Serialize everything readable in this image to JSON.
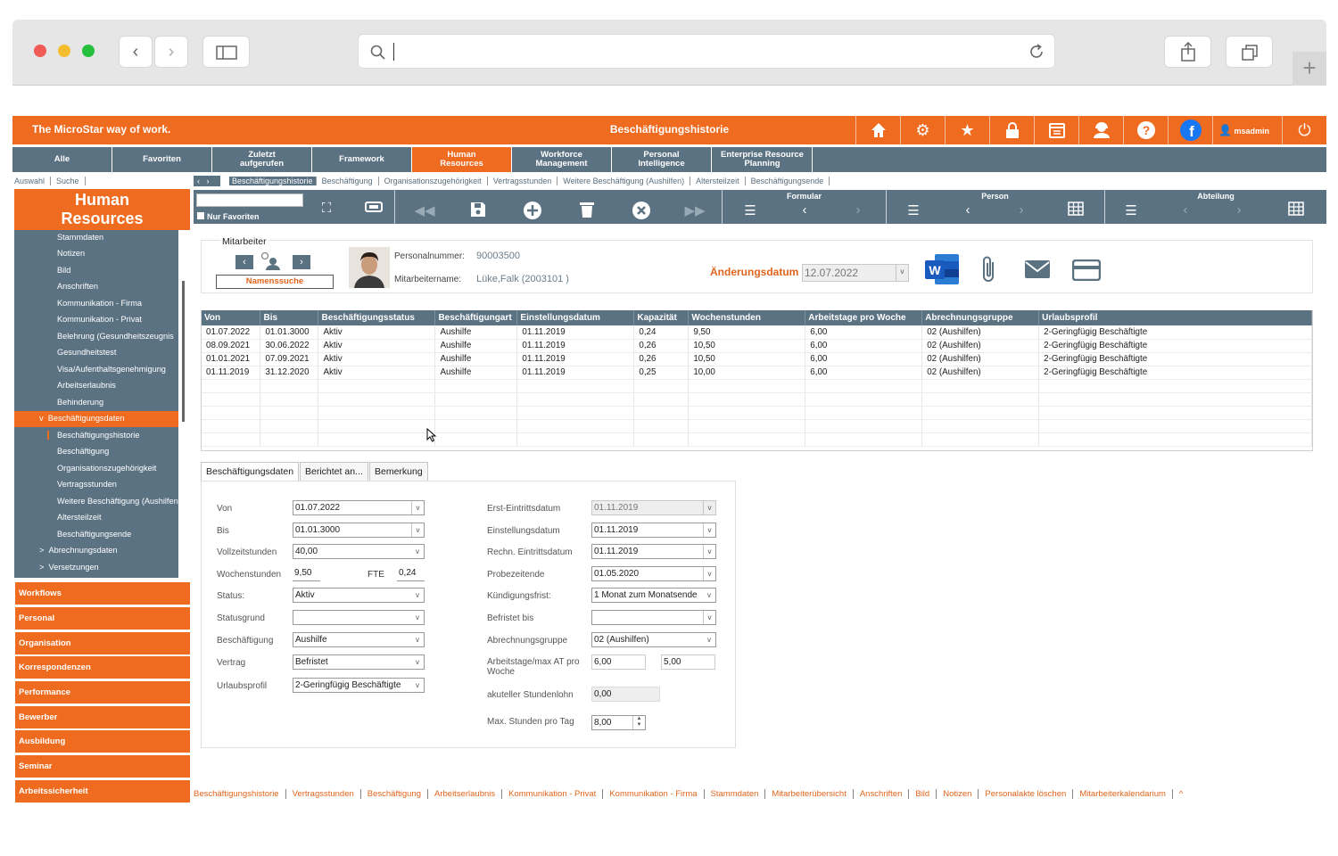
{
  "brand": "The MicroStar way of work.",
  "title": "Beschäftigungshistorie",
  "user": "msadmin",
  "nav": [
    {
      "label": "Alle"
    },
    {
      "label": "Favoriten"
    },
    {
      "label": "Zuletzt aufgerufen"
    },
    {
      "label": "Framework"
    },
    {
      "label": "Human Resources"
    },
    {
      "label": "Workforce Management"
    },
    {
      "label": "Personal Intelligence"
    },
    {
      "label": "Enterprise Resource Planning"
    }
  ],
  "subnav": {
    "left": [
      "Auswahl",
      "Suche"
    ],
    "crumbs": [
      "Beschäftigungshistorie",
      "Beschäftigung",
      "Organisationszugehörigkeit",
      "Vertragsstunden",
      "Weitere Beschäftigung (Aushilfen)",
      "Altersteilzeit",
      "Beschäftigungsende"
    ]
  },
  "module": {
    "title": "Human Resources"
  },
  "tree": [
    "Stammdaten",
    "Notizen",
    "Bild",
    "Anschriften",
    "Kommunikation - Firma",
    "Kommunikation - Privat",
    "Belehrung (Gesundheitszeugnis",
    "Gesundheitstest",
    "Visa/Aufenthaltsgenehmigung",
    "Arbeitserlaubnis",
    "Behinderung",
    "Beschäftigungsdaten",
    "Beschäftigungshistorie",
    "Beschäftigung",
    "Organisationszugehörigkeit",
    "Vertragsstunden",
    "Weitere Beschäftigung (Aushilfen",
    "Altersteilzeit",
    "Beschäftigungsende",
    "Abrechnungsdaten",
    "Versetzungen"
  ],
  "modules": [
    "Workflows",
    "Personal",
    "Organisation",
    "Korrespondenzen",
    "Performance",
    "Bewerber",
    "Ausbildung",
    "Seminar",
    "Arbeitssicherheit"
  ],
  "toolbar": {
    "favorites": "Nur Favoriten",
    "groups": [
      "Formular",
      "Person",
      "Abteilung"
    ]
  },
  "employee": {
    "section": "Mitarbeiter",
    "search": "Namenssuche",
    "nr_label": "Personalnummer:",
    "nr": "90003500",
    "name_label": "Mitarbeitername:",
    "name": "Lüke,Falk (2003101 )",
    "change_label": "Änderungsdatum",
    "change_date": "12.07.2022"
  },
  "table": {
    "columns": [
      "Von",
      "Bis",
      "Beschäftigungsstatus",
      "Beschäftigungart",
      "Einstellungsdatum",
      "Kapazität",
      "Wochenstunden",
      "Arbeitstage pro Woche",
      "Abrechnungsgruppe",
      "Urlaubsprofil"
    ],
    "rows": [
      [
        "01.07.2022",
        "01.01.3000",
        "Aktiv",
        "Aushilfe",
        "01.11.2019",
        "0,24",
        "9,50",
        "6,00",
        "02 (Aushilfen)",
        "2-Geringfügig Beschäftigte"
      ],
      [
        "08.09.2021",
        "30.06.2022",
        "Aktiv",
        "Aushilfe",
        "01.11.2019",
        "0,26",
        "10,50",
        "6,00",
        "02 (Aushilfen)",
        "2-Geringfügig Beschäftigte"
      ],
      [
        "01.01.2021",
        "07.09.2021",
        "Aktiv",
        "Aushilfe",
        "01.11.2019",
        "0,26",
        "10,50",
        "6,00",
        "02 (Aushilfen)",
        "2-Geringfügig Beschäftigte"
      ],
      [
        "01.11.2019",
        "31.12.2020",
        "Aktiv",
        "Aushilfe",
        "01.11.2019",
        "0,25",
        "10,00",
        "6,00",
        "02 (Aushilfen)",
        "2-Geringfügig Beschäftigte"
      ]
    ]
  },
  "tabs": [
    "Beschäftigungsdaten",
    "Berichtet an...",
    "Bemerkung"
  ],
  "form": {
    "left": [
      {
        "label": "Von",
        "value": "01.07.2022"
      },
      {
        "label": "Bis",
        "value": "01.01.3000"
      },
      {
        "label": "Vollzeitstunden",
        "value": "40,00"
      },
      {
        "label": "Wochenstunden",
        "value": "9,50"
      },
      {
        "label": "Status:",
        "value": "Aktiv"
      },
      {
        "label": "Statusgrund",
        "value": ""
      },
      {
        "label": "Beschäftigung",
        "value": "Aushilfe"
      },
      {
        "label": "Vertrag",
        "value": "Befristet"
      },
      {
        "label": "Urlaubsprofil",
        "value": "2-Geringfügig Beschäftigte"
      }
    ],
    "fte_label": "FTE",
    "fte": "0,24",
    "right": [
      {
        "label": "Erst-Eintrittsdatum",
        "value": "01.11.2019"
      },
      {
        "label": "Einstellungsdatum",
        "value": "01.11.2019"
      },
      {
        "label": "Rechn. Eintrittsdatum",
        "value": "01.11.2019"
      },
      {
        "label": "Probezeitende",
        "value": "01.05.2020"
      },
      {
        "label": "Kündigungsfrist:",
        "value": "1 Monat zum Monatsende"
      },
      {
        "label": "Befristet bis",
        "value": ""
      },
      {
        "label": "Abrechnungsgruppe",
        "value": "02 (Aushilfen)"
      },
      {
        "label": "Arbeitstage/max AT pro Woche",
        "value": "6,00",
        "value2": "5,00"
      },
      {
        "label": "akuteller Stundenlohn",
        "value": "0,00"
      },
      {
        "label": "Max. Stunden pro Tag",
        "value": "8,00"
      }
    ]
  },
  "bottom_links": [
    "Beschäftigungshistorie",
    "Vertragsstunden",
    "Beschäftigung",
    "Arbeitserlaubnis",
    "Kommunikation - Privat",
    "Kommunikation - Firma",
    "Stammdaten",
    "Mitarbeiterübersicht",
    "Anschriften",
    "Bild",
    "Notizen",
    "Personalakte löschen",
    "Mitarbeiterkalendarium",
    "^"
  ],
  "colors": {
    "accent": "#ef6b1f",
    "nav": "#5b7283"
  }
}
